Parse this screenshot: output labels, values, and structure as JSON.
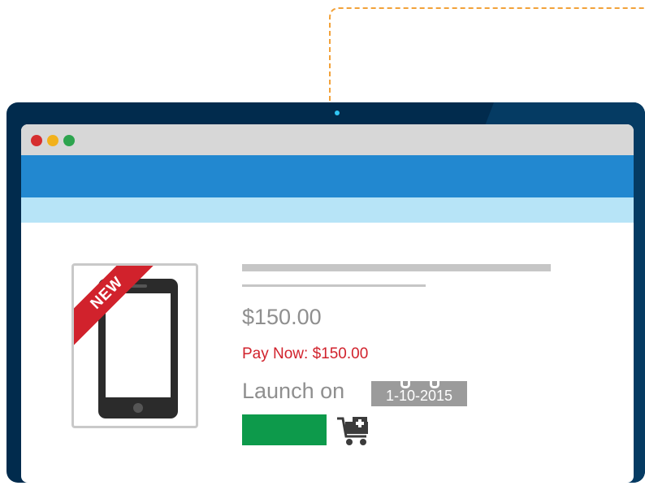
{
  "colors": {
    "monitor_frame": "#012b4d",
    "navbar": "#2288d0",
    "subbar": "#b7e4f7",
    "titlebar": "#d7d7d7",
    "new_ribbon": "#d1222c",
    "pay_now_text": "#d1222c",
    "buy_button": "#0d9a4b",
    "date_badge": "#9b9b9b",
    "connector": "#f2a23a",
    "camera": "#31c6f4"
  },
  "window_controls": [
    "close-dot",
    "minimize-dot",
    "maximize-dot"
  ],
  "product": {
    "badge": "NEW",
    "image_icon": "smartphone-icon",
    "price": "$150.00",
    "pay_now": "Pay Now: $150.00",
    "launch_label": "Launch on",
    "launch_date": "1-10-2015",
    "date_icon": "calendar-icon",
    "cart_icon": "add-to-cart-icon"
  }
}
